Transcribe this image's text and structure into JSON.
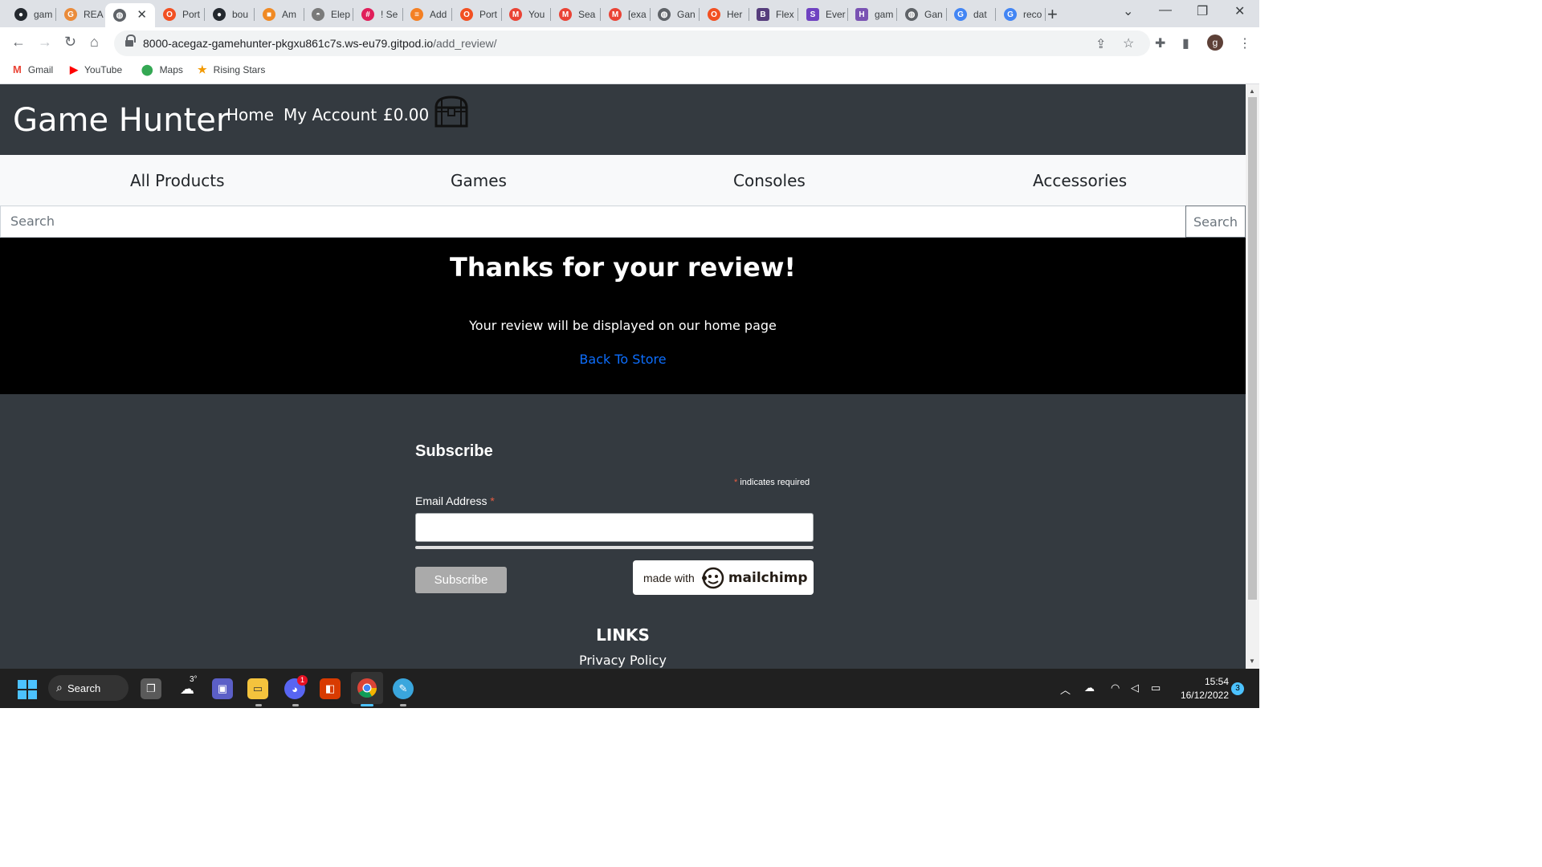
{
  "browser": {
    "tabs": [
      {
        "title": "gam",
        "icon": "github-icon",
        "color": "#24292f"
      },
      {
        "title": "REA",
        "icon": "g-icon",
        "color": "#ea8b3a"
      },
      {
        "title": "",
        "icon": "globe-icon",
        "color": "#5f6368",
        "active": true
      },
      {
        "title": "Port",
        "icon": "opera-icon",
        "color": "#f25022"
      },
      {
        "title": "bou",
        "icon": "github-icon",
        "color": "#24292f"
      },
      {
        "title": "Am",
        "icon": "box-icon",
        "color": "#f08a24"
      },
      {
        "title": "Elep",
        "icon": "elephant-icon",
        "color": "#7a7a7a"
      },
      {
        "title": "! Se",
        "icon": "slack-icon",
        "color": "#e01e5a"
      },
      {
        "title": "Add",
        "icon": "stackoverflow-icon",
        "color": "#f48024"
      },
      {
        "title": "Port",
        "icon": "opera-icon",
        "color": "#f25022"
      },
      {
        "title": "You",
        "icon": "gmail-icon",
        "color": "#ea4335"
      },
      {
        "title": "Sea",
        "icon": "gmail-icon",
        "color": "#ea4335"
      },
      {
        "title": "[exa",
        "icon": "gmail-icon",
        "color": "#ea4335"
      },
      {
        "title": "Gan",
        "icon": "globe-icon",
        "color": "#5f6368"
      },
      {
        "title": "Her",
        "icon": "opera-icon",
        "color": "#f25022"
      },
      {
        "title": "Flex",
        "icon": "bootstrap-icon",
        "color": "#563d7c"
      },
      {
        "title": "Ever",
        "icon": "s-icon",
        "color": "#6f42c1"
      },
      {
        "title": "gam",
        "icon": "h-icon",
        "color": "#7952b3"
      },
      {
        "title": "Gan",
        "icon": "globe-icon",
        "color": "#5f6368"
      },
      {
        "title": "dat",
        "icon": "google-icon",
        "color": "#4285f4"
      },
      {
        "title": "reco",
        "icon": "google-icon",
        "color": "#4285f4"
      }
    ],
    "url_host": "8000-acegaz-gamehunter-pkgxu861c7s.ws-eu79.gitpod.io",
    "url_path": "/add_review/",
    "profile_initial": "g",
    "bookmarks": [
      {
        "label": "Gmail",
        "icon": "gmail-icon",
        "color": "#ea4335"
      },
      {
        "label": "YouTube",
        "icon": "youtube-icon",
        "color": "#ff0000"
      },
      {
        "label": "Maps",
        "icon": "maps-pin-icon",
        "color": "#34a853"
      },
      {
        "label": "Rising Stars",
        "icon": "star-icon",
        "color": "#f29900"
      }
    ]
  },
  "site": {
    "brand": "Game Hunter",
    "nav": {
      "home": "Home",
      "account": "My Account",
      "basket_total": "£0.00"
    },
    "categories": [
      "All Products",
      "Games",
      "Consoles",
      "Accessories"
    ],
    "search": {
      "placeholder": "Search",
      "button": "Search"
    },
    "confirmation": {
      "heading": "Thanks for your review!",
      "message": "Your review will be displayed on our home page",
      "link": "Back To Store"
    },
    "subscribe": {
      "title": "Subscribe",
      "required_star": "*",
      "required_note": "indicates required",
      "email_label": "Email Address",
      "button": "Subscribe",
      "badge_prefix": "made with",
      "badge_brand": "mailchimp"
    },
    "footer": {
      "links_title": "LINKS",
      "privacy": "Privacy Policy"
    }
  },
  "taskbar": {
    "search_label": "Search",
    "weather_temp": "3°",
    "discord_badge": "1",
    "time": "15:54",
    "date": "16/12/2022",
    "notification_count": "3"
  },
  "colors": {
    "header_bg": "#343a40",
    "catbar_bg": "#f8f9fa",
    "banner_bg": "#000000",
    "link_blue": "#0d6efd",
    "required_red": "#e85c41"
  }
}
